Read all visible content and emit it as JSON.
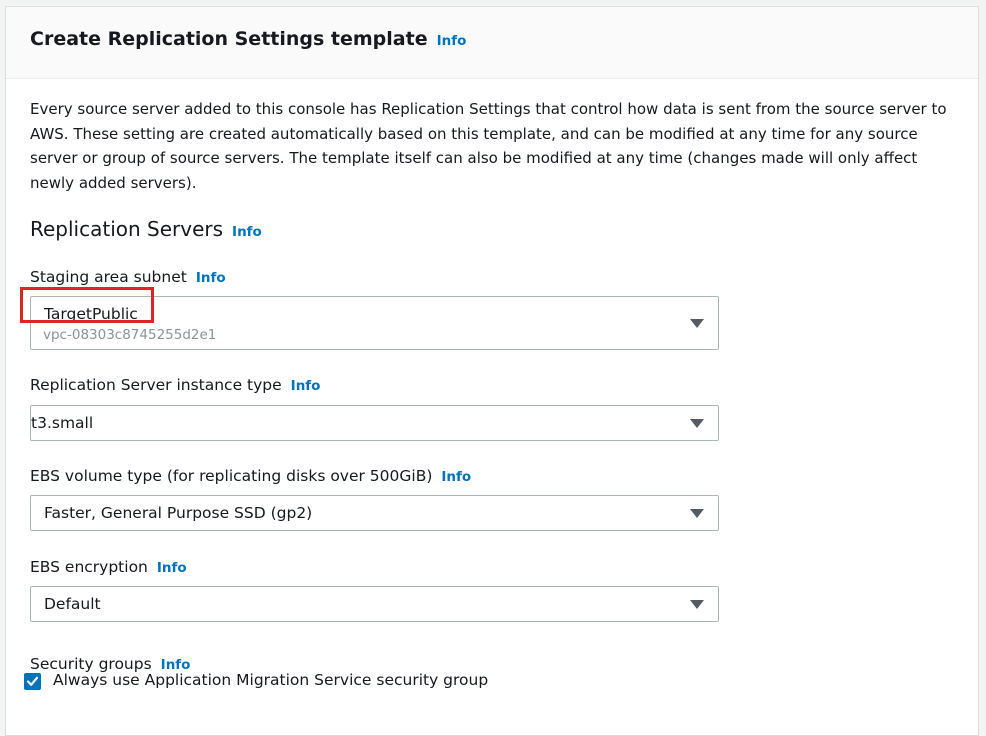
{
  "header": {
    "title": "Create Replication Settings template",
    "info": "Info"
  },
  "description": "Every source server added to this console has Replication Settings that control how data is sent from the source server to AWS. These setting are created automatically based on this template, and can be modified at any time for any source server or group of source servers. The template itself can also be modified at any time (changes made will only affect newly added servers).",
  "section": {
    "title": "Replication Servers",
    "info": "Info"
  },
  "fields": {
    "staging_subnet": {
      "label": "Staging area subnet",
      "info": "Info",
      "value": "TargetPublic",
      "sub_value": "vpc-08303c8745255d2e1"
    },
    "instance_type": {
      "label": "Replication Server instance type",
      "info": "Info",
      "value": "t3.small"
    },
    "ebs_volume_type": {
      "label": "EBS volume type (for replicating disks over 500GiB)",
      "info": "Info",
      "value": "Faster, General Purpose SSD (gp2)"
    },
    "ebs_encryption": {
      "label": "EBS encryption",
      "info": "Info",
      "value": "Default"
    },
    "security_groups": {
      "label": "Security groups",
      "info": "Info",
      "checkbox_label": "Always use Application Migration Service security group",
      "checked": true
    }
  },
  "colors": {
    "link": "#0073bb",
    "highlight": "#e02424",
    "checkbox": "#0073bb"
  }
}
